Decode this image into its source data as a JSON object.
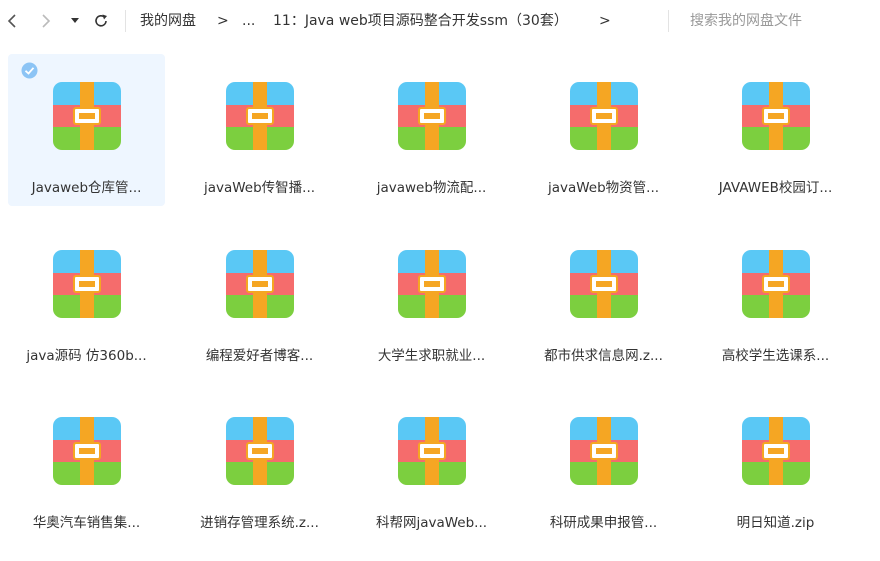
{
  "toolbar": {
    "breadcrumb": {
      "root": "我的网盘",
      "sep1": ">",
      "ellipsis": "...",
      "current": "11：Java web项目源码整合开发ssm（30套）",
      "sep2": ">"
    },
    "search_placeholder": "搜索我的网盘文件"
  },
  "colors": {
    "zip_top": "#5ac8f5",
    "zip_mid": "#f56c6c",
    "zip_bottom": "#7ccf3f",
    "zip_strap": "#f5a623",
    "selected_bg": "#eef6ff",
    "check": "#8cc4f5"
  },
  "files": [
    {
      "name": "Javaweb仓库管...",
      "icon": "zip-archive-icon",
      "selected": true
    },
    {
      "name": "javaWeb传智播...",
      "icon": "zip-archive-icon",
      "selected": false
    },
    {
      "name": "javaweb物流配...",
      "icon": "zip-archive-icon",
      "selected": false
    },
    {
      "name": "javaWeb物资管...",
      "icon": "zip-archive-icon",
      "selected": false
    },
    {
      "name": "JAVAWEB校园订...",
      "icon": "zip-archive-icon",
      "selected": false
    },
    {
      "name": "java源码 仿360b...",
      "icon": "zip-archive-icon",
      "selected": false
    },
    {
      "name": "编程爱好者博客...",
      "icon": "zip-archive-icon",
      "selected": false
    },
    {
      "name": "大学生求职就业...",
      "icon": "zip-archive-icon",
      "selected": false
    },
    {
      "name": "都市供求信息网.z...",
      "icon": "zip-archive-icon",
      "selected": false
    },
    {
      "name": "高校学生选课系...",
      "icon": "zip-archive-icon",
      "selected": false
    },
    {
      "name": "华奥汽车销售集...",
      "icon": "zip-archive-icon",
      "selected": false
    },
    {
      "name": "进销存管理系统.z...",
      "icon": "zip-archive-icon",
      "selected": false
    },
    {
      "name": "科帮网javaWeb...",
      "icon": "zip-archive-icon",
      "selected": false
    },
    {
      "name": "科研成果申报管...",
      "icon": "zip-archive-icon",
      "selected": false
    },
    {
      "name": "明日知道.zip",
      "icon": "zip-archive-icon",
      "selected": false
    }
  ]
}
